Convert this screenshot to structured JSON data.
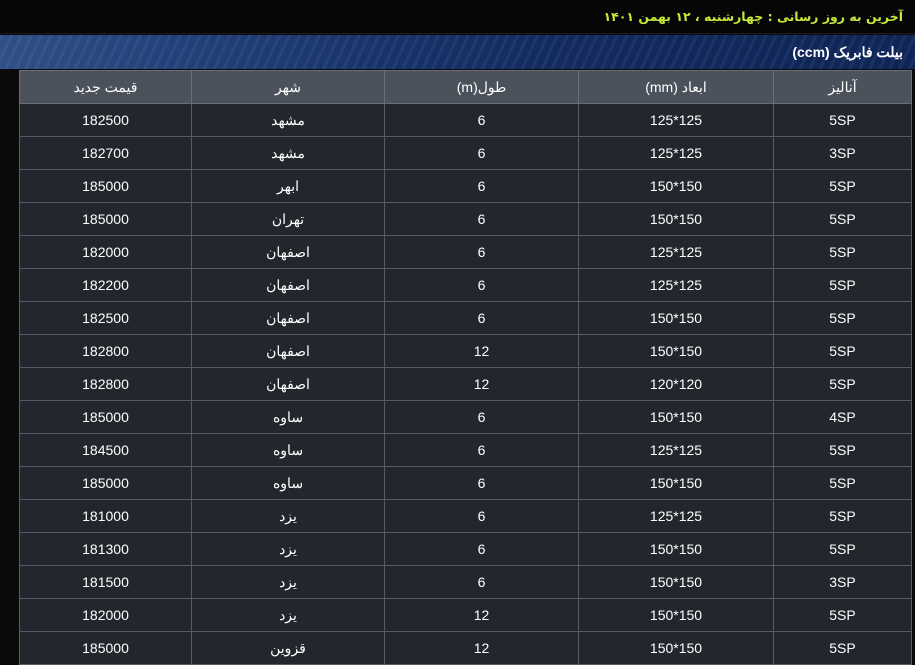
{
  "update_bar": {
    "text": "آخرین به روز رسانی : چهارشنبه ، ۱۲ بهمن ۱۴۰۱"
  },
  "title_bar": {
    "title": "بیلت فابریک (ccm)"
  },
  "table": {
    "headers": [
      "آنالیز",
      "ابعاد (mm)",
      "طول(m)",
      "شهر",
      "قیمت جدید"
    ],
    "rows": [
      [
        "5SP",
        "125*125",
        "6",
        "مشهد",
        "182500"
      ],
      [
        "3SP",
        "125*125",
        "6",
        "مشهد",
        "182700"
      ],
      [
        "5SP",
        "150*150",
        "6",
        "ابهر",
        "185000"
      ],
      [
        "5SP",
        "150*150",
        "6",
        "تهران",
        "185000"
      ],
      [
        "5SP",
        "125*125",
        "6",
        "اصفهان",
        "182000"
      ],
      [
        "5SP",
        "125*125",
        "6",
        "اصفهان",
        "182200"
      ],
      [
        "5SP",
        "150*150",
        "6",
        "اصفهان",
        "182500"
      ],
      [
        "5SP",
        "150*150",
        "12",
        "اصفهان",
        "182800"
      ],
      [
        "5SP",
        "120*120",
        "12",
        "اصفهان",
        "182800"
      ],
      [
        "4SP",
        "150*150",
        "6",
        "ساوه",
        "185000"
      ],
      [
        "5SP",
        "125*125",
        "6",
        "ساوه",
        "184500"
      ],
      [
        "5SP",
        "150*150",
        "6",
        "ساوه",
        "185000"
      ],
      [
        "5SP",
        "125*125",
        "6",
        "یزد",
        "181000"
      ],
      [
        "5SP",
        "150*150",
        "6",
        "یزد",
        "181300"
      ],
      [
        "3SP",
        "150*150",
        "6",
        "یزد",
        "181500"
      ],
      [
        "5SP",
        "150*150",
        "12",
        "یزد",
        "182000"
      ],
      [
        "5SP",
        "150*150",
        "12",
        "قزوین",
        "185000"
      ]
    ]
  },
  "colors": {
    "update_text": "#c6e83a",
    "header_bg": "#4b525c",
    "row_bg": "#23262d",
    "title_bg": "#18336a"
  }
}
